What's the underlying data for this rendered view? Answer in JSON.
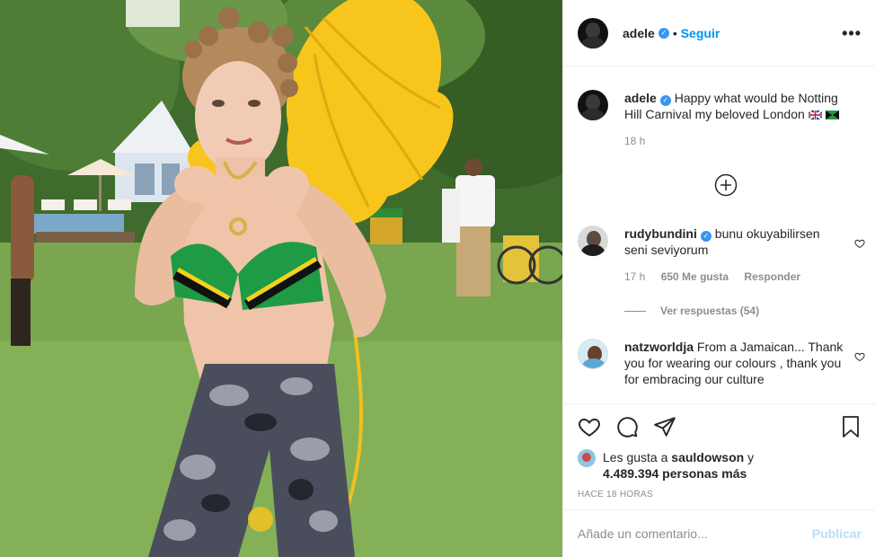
{
  "post": {
    "username": "adele",
    "follow_label": "Seguir",
    "more_label": "•••"
  },
  "caption": {
    "username": "adele",
    "text": "Happy what would be Notting Hill Carnival my beloved London",
    "time": "18 h"
  },
  "comments": [
    {
      "username": "rudybundini",
      "text": "bunu okuyabilirsen seni seviyorum",
      "time": "17 h",
      "likes": "650 Me gusta",
      "reply_label": "Responder",
      "view_replies": "Ver respuestas (54)"
    },
    {
      "username": "natzworldja",
      "text": "From a Jamaican... Thank you for wearing our colours , thank you for embracing our culture"
    }
  ],
  "likes": {
    "prefix": "Les gusta a",
    "user": "sauldowson",
    "conjunction": "y",
    "count_text": "4.489.394 personas más"
  },
  "timestamp": "HACE 18 HORAS",
  "add_comment": {
    "placeholder": "Añade un comentario...",
    "publish_label": "Publicar"
  },
  "colors": {
    "link_blue": "#0095f6",
    "verified_blue": "#3897f0",
    "publish_disabled": "#b2dffc",
    "secondary_text": "#8e8e8e"
  },
  "icons": [
    "verified-icon",
    "more-icon",
    "add-circle-icon",
    "heart-icon",
    "comment-icon",
    "share-icon",
    "bookmark-icon"
  ]
}
